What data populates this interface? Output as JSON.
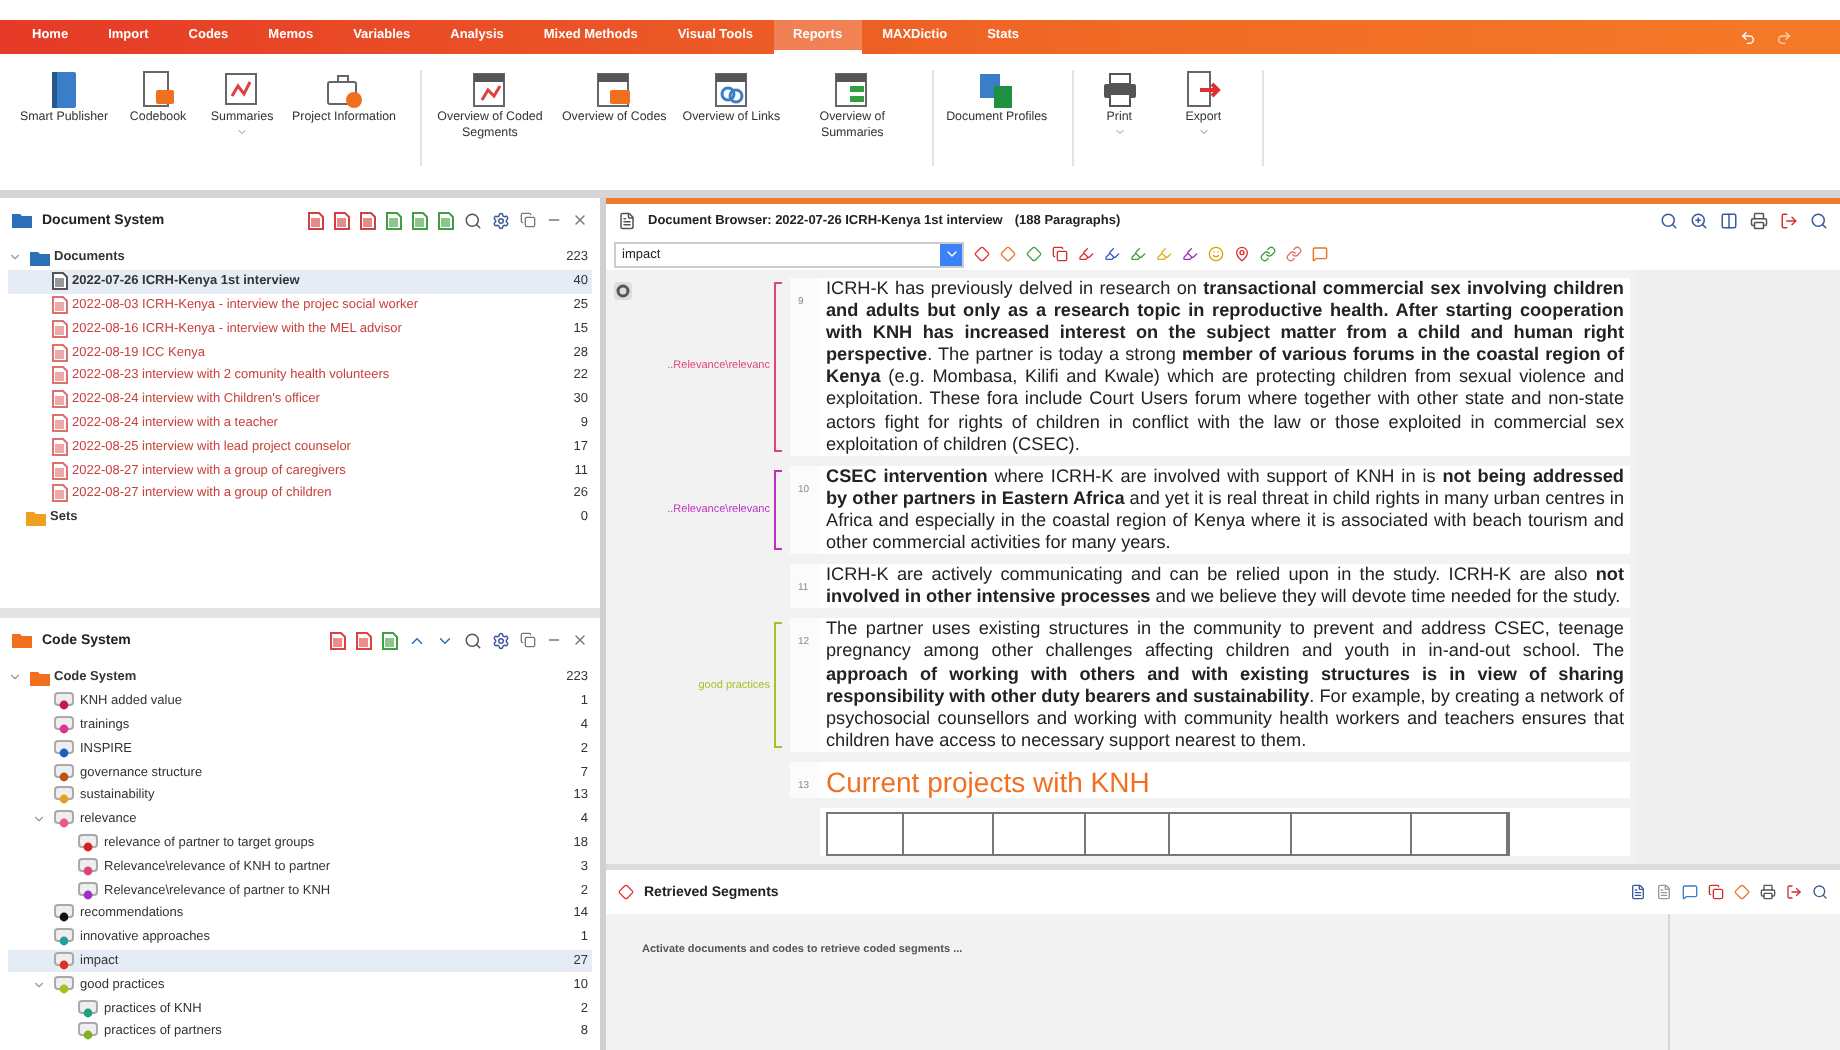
{
  "menu_tabs": [
    {
      "label": "Home",
      "selected": false
    },
    {
      "label": "Import",
      "selected": false
    },
    {
      "label": "Codes",
      "selected": false
    },
    {
      "label": "Memos",
      "selected": false
    },
    {
      "label": "Variables",
      "selected": false
    },
    {
      "label": "Analysis",
      "selected": false
    },
    {
      "label": "Mixed Methods",
      "selected": false
    },
    {
      "label": "Visual Tools",
      "selected": false
    },
    {
      "label": "Reports",
      "selected": true
    },
    {
      "label": "MAXDictio",
      "selected": false
    },
    {
      "label": "Stats",
      "selected": false
    }
  ],
  "ribbon_groups": [
    [
      {
        "label": "Smart Publisher",
        "dropdown": false
      },
      {
        "label": "Codebook",
        "dropdown": false
      },
      {
        "label": "Summaries",
        "dropdown": true
      },
      {
        "label": "Project Information",
        "dropdown": false
      }
    ],
    [
      {
        "label": "Overview of Coded Segments",
        "dropdown": false
      },
      {
        "label": "Overview of Codes",
        "dropdown": false
      },
      {
        "label": "Overview of Links",
        "dropdown": false
      },
      {
        "label": "Overview of Summaries",
        "dropdown": false
      }
    ],
    [
      {
        "label": "Document Profiles",
        "dropdown": false
      }
    ],
    [
      {
        "label": "Print",
        "dropdown": true
      },
      {
        "label": "Export",
        "dropdown": true
      }
    ]
  ],
  "document_system": {
    "title": "Document System",
    "root": {
      "label": "Documents",
      "count": "223",
      "expanded": true,
      "children": [
        {
          "label": "2022-07-26 ICRH-Kenya 1st interview",
          "count": "40",
          "selected": true
        },
        {
          "label": "2022-08-03 ICRH-Kenya - interview the projec social worker",
          "count": "25",
          "selected": false
        },
        {
          "label": "2022-08-16 ICRH-Kenya - interview with the MEL advisor",
          "count": "15",
          "selected": false
        },
        {
          "label": "2022-08-19 ICC Kenya",
          "count": "28",
          "selected": false
        },
        {
          "label": "2022-08-23 interview with 2 comunity health volunteers",
          "count": "22",
          "selected": false
        },
        {
          "label": "2022-08-24 interview with Children's officer",
          "count": "30",
          "selected": false
        },
        {
          "label": "2022-08-24 interview with a teacher",
          "count": "9",
          "selected": false
        },
        {
          "label": "2022-08-25 interview with lead project counselor",
          "count": "17",
          "selected": false
        },
        {
          "label": "2022-08-27 interview with a group of caregivers",
          "count": "11",
          "selected": false
        },
        {
          "label": "2022-08-27 interview with a group of children",
          "count": "26",
          "selected": false
        }
      ]
    },
    "sets": {
      "label": "Sets",
      "count": "0"
    }
  },
  "code_system": {
    "title": "Code System",
    "root": {
      "label": "Code System",
      "count": "223",
      "expanded": true,
      "children": [
        {
          "label": "KNH added value",
          "count": "1",
          "color": "#c2185b",
          "selected": false
        },
        {
          "label": "trainings",
          "count": "4",
          "color": "#e0358c",
          "selected": false
        },
        {
          "label": "INSPIRE",
          "count": "2",
          "color": "#1f5fbf",
          "selected": false
        },
        {
          "label": "governance structure",
          "count": "7",
          "color": "#c0501a",
          "selected": false
        },
        {
          "label": "sustainability",
          "count": "13",
          "color": "#e8a020",
          "selected": false
        },
        {
          "label": "relevance",
          "count": "4",
          "color": "#e65a8a",
          "selected": false,
          "expanded": true,
          "children": [
            {
              "label": "relevance of partner to target groups",
              "count": "18",
              "color": "#d32020",
              "selected": false
            },
            {
              "label": "Relevance\\relevance of KNH to partner",
              "count": "3",
              "color": "#e0457a",
              "selected": false
            },
            {
              "label": "Relevance\\relevance of partner to KNH",
              "count": "2",
              "color": "#a030c0",
              "selected": false
            }
          ]
        },
        {
          "label": "recommendations",
          "count": "14",
          "color": "#111111",
          "selected": false
        },
        {
          "label": "innovative approaches",
          "count": "1",
          "color": "#20a0a0",
          "selected": false
        },
        {
          "label": "impact",
          "count": "27",
          "color": "#e03020",
          "selected": true
        },
        {
          "label": "good practices",
          "count": "10",
          "color": "#a8c020",
          "selected": false,
          "expanded": true,
          "children": [
            {
              "label": "practices of KNH",
              "count": "2",
              "color": "#20a080",
              "selected": false
            },
            {
              "label": "practices of partners",
              "count": "8",
              "color": "#80b020",
              "selected": false
            }
          ]
        }
      ]
    }
  },
  "document_browser": {
    "title": "Document Browser: 2022-07-26 ICRH-Kenya 1st interview",
    "paragraph_count": "(188 Paragraphs)",
    "code_filter": "impact",
    "paragraphs": [
      {
        "kind": "text",
        "number": "9",
        "text": "ICRH-K has previously delved in research on **transactional commercial sex involving children and adults but only as a research topic in reproductive health. After starting cooperation with KNH has increased interest on the subject matter from a child and human right perspective**. The partner is today a strong **member of various forums in the coastal region of Kenya** (e.g. Mombasa, Kilifi and Kwale) which are protecting children from sexual violence and exploitation. These fora include Court Users forum where together with other state and non-state actors fight for rights of children in conflict with the law or those exploited in commercial sex exploitation of children (CSEC).",
        "coding": {
          "label": "..Relevance\\relevanc",
          "color": "#e0457a"
        }
      },
      {
        "kind": "text",
        "number": "10",
        "text": "**CSEC intervention** where ICRH-K are involved with support of KNH in is **not being addressed by other partners in Eastern Africa** and yet it is real threat in child rights in many urban centres in Africa and especially in the coastal region of Kenya where it is associated with beach tourism and other commercial activities for many years.",
        "coding": {
          "label": "..Relevance\\relevanc",
          "color": "#c030c0"
        }
      },
      {
        "kind": "text",
        "number": "11",
        "text": "ICRH-K are actively communicating and can be relied upon in the study. ICRH-K are also **not involved in other intensive processes** and we believe they will devote time needed for the study."
      },
      {
        "kind": "text",
        "number": "12",
        "text": "The partner uses existing structures in the community to prevent and address CSEC, teenage pregnancy among other challenges affecting children and youth in in-and-out school. The **approach of working with others and with existing structures is in view of sharing responsibility with other duty bearers and sustainability**. For example, by creating a network of psychosocial counsellors and working with community health workers and teachers ensures that children have access to necessary support nearest to them.",
        "coding": {
          "label": "good practices",
          "color": "#a8c020"
        }
      },
      {
        "kind": "heading",
        "number": "13",
        "text": "Current projects with KNH"
      },
      {
        "kind": "table"
      }
    ]
  },
  "retrieved_segments": {
    "title": "Retrieved Segments",
    "message": "Activate documents and codes to retrieve coded segments ..."
  }
}
